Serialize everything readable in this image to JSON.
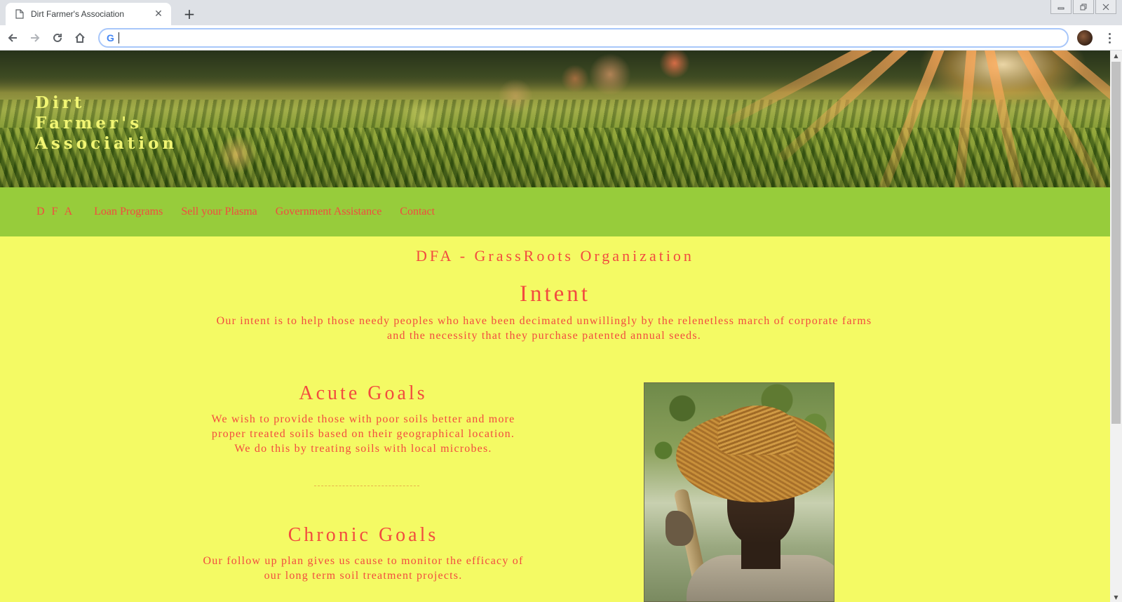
{
  "browser": {
    "tab_title": "Dirt Farmer's Association",
    "tab_close": "✕",
    "new_tab": "+",
    "omnibox_value": "",
    "omnibox_placeholder": "",
    "omnibox_icon": "G",
    "icons": [
      "page-icon",
      "back-icon",
      "forward-icon",
      "reload-icon",
      "home-icon",
      "google-icon",
      "profile-avatar",
      "menu-icon",
      "minimize-icon",
      "restore-icon",
      "close-icon"
    ]
  },
  "site": {
    "title_lines": [
      "Dirt",
      "Farmer's",
      "Association"
    ]
  },
  "nav": {
    "items": [
      "D F A",
      "Loan Programs",
      "Sell your Plasma",
      "Government Assistance",
      "Contact"
    ]
  },
  "content": {
    "org_heading": "DFA - GrassRoots Organization",
    "intent": {
      "heading": "Intent",
      "text": "Our intent is to help those needy peoples who have been decimated unwillingly by the relenetless march of corporate farms and the necessity that they purchase patented annual seeds."
    },
    "acute": {
      "heading": "Acute Goals",
      "text": "We wish to provide those with poor soils better and more proper treated soils based on their geographical location. We do this by treating soils with local microbes."
    },
    "chronic": {
      "heading": "Chronic Goals",
      "text": "Our follow up plan gives us cause to monitor the efficacy of our long term soil treatment projects."
    }
  },
  "colors": {
    "page_bg": "#f4fa64",
    "nav_bg": "#97cc3b",
    "accent_text": "#f24b3f",
    "title_text": "#f1f573"
  }
}
